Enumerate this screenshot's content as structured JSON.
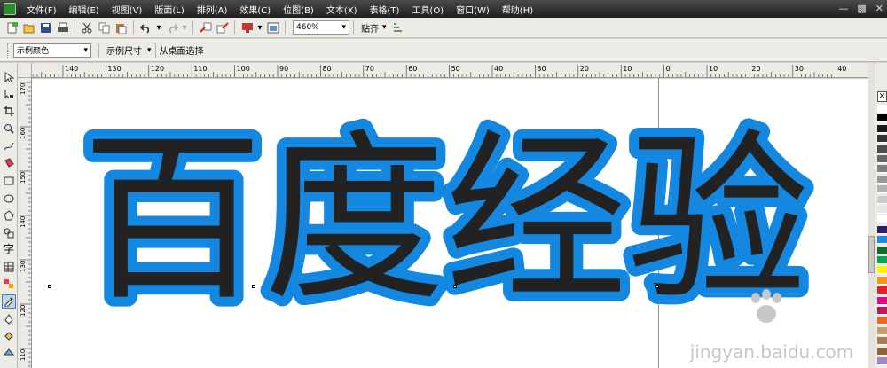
{
  "menubar": {
    "items": [
      "文件(F)",
      "编辑(E)",
      "视图(V)",
      "版面(L)",
      "排列(A)",
      "效果(C)",
      "位图(B)",
      "文本(X)",
      "表格(T)",
      "工具(O)",
      "窗口(W)",
      "帮助(H)"
    ]
  },
  "toolbar": {
    "zoom_value": "460%",
    "snap_label": "贴齐"
  },
  "property_bar": {
    "color_select_value": "示例颜色",
    "size_label": "示例尺寸",
    "desktop_select_label": "从桌面选择"
  },
  "rulers": {
    "horizontal_ticks": [
      "140",
      "130",
      "120",
      "110",
      "100",
      "90",
      "80",
      "70",
      "60",
      "50",
      "40",
      "30",
      "20",
      "10",
      "0",
      "10",
      "20",
      "30",
      "40"
    ],
    "vertical_ticks": [
      "170",
      "160",
      "150",
      "140",
      "130",
      "120",
      "110"
    ]
  },
  "canvas": {
    "artwork_text": "百度经验",
    "outline_color": "#1487e0",
    "fill_color": "#222222",
    "watermark_site": "jingyan.baidu.com"
  },
  "palette": {
    "colors": [
      "#ffffff",
      "#000000",
      "#1a1a1a",
      "#333333",
      "#4d4d4d",
      "#666666",
      "#808080",
      "#999999",
      "#b3b3b3",
      "#cccccc",
      "#e6e6e6",
      "#ffffff",
      "#2e1a6b",
      "#1f8ae6",
      "#0d6e2e",
      "#00a651",
      "#fff200",
      "#f7941d",
      "#ed1c24",
      "#ec008c",
      "#c2185b",
      "#f26522",
      "#c69c6d",
      "#a67c52",
      "#8c6239",
      "#9e86c8"
    ]
  }
}
